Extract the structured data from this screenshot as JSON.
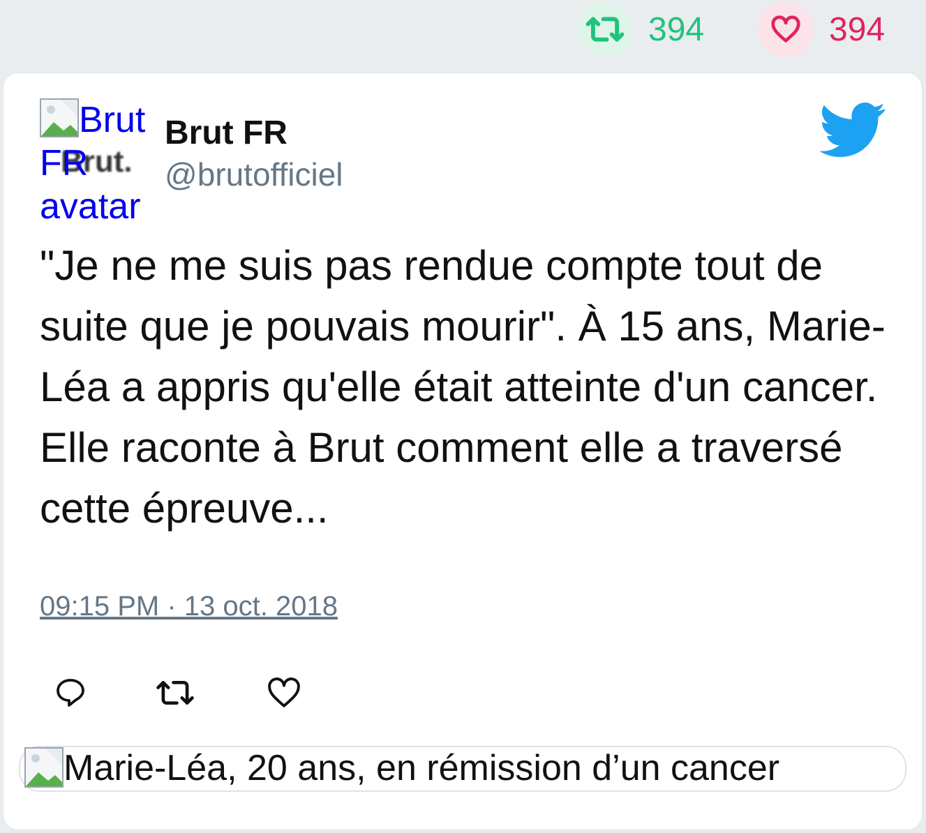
{
  "top_stats": {
    "retweets": "394",
    "likes": "394",
    "retweet_color": "#1ec47a",
    "like_color": "#e0245e",
    "retweet_icon": "retweet-icon",
    "like_icon": "heart-icon"
  },
  "tweet": {
    "avatar_alt": "Brut FR avatar",
    "avatar_logo": "Brut.",
    "author_name": "Brut FR",
    "handle": "@brutofficiel",
    "brand_icon": "twitter-bird-icon",
    "brand_color": "#1da1f2",
    "text": "\"Je ne me suis pas rendue compte tout de suite que je pouvais mourir\". À 15 ans, Marie-Léa a appris qu'elle était atteinte d'un cancer. Elle raconte à Brut comment elle a traversé cette épreuve...",
    "timestamp": "09:15 PM · 13 oct. 2018",
    "actions": {
      "reply_icon": "reply-icon",
      "retweet_icon": "retweet-icon",
      "like_icon": "heart-icon"
    },
    "media_alt": "Marie-Léa, 20 ans, en rémission d’un cancer"
  }
}
